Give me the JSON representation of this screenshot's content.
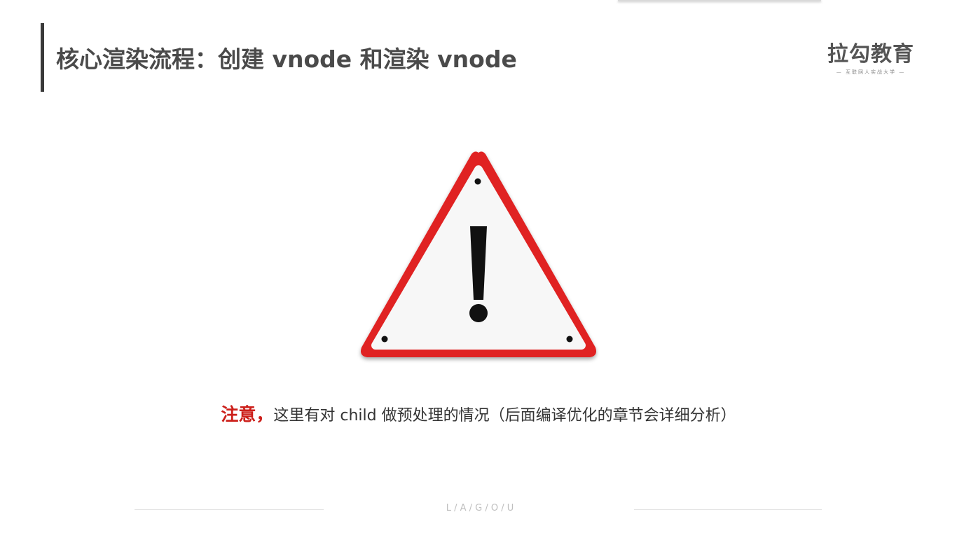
{
  "header": {
    "title": "核心渲染流程：创建 vnode 和渲染 vnode"
  },
  "logo": {
    "main": "拉勾教育",
    "sub": "— 互联网人实战大学 —"
  },
  "warning": {
    "icon": "warning-triangle-icon",
    "symbol": "!",
    "border_color": "#e02020",
    "fill_color": "#f7f7f7"
  },
  "note": {
    "label": "注意，",
    "text": "这里有对 child 做预处理的情况（后面编译优化的章节会详细分析）",
    "label_color": "#cc1f1a"
  },
  "footer": {
    "brand": "L  /  A  /  G  /  O  /  U"
  }
}
